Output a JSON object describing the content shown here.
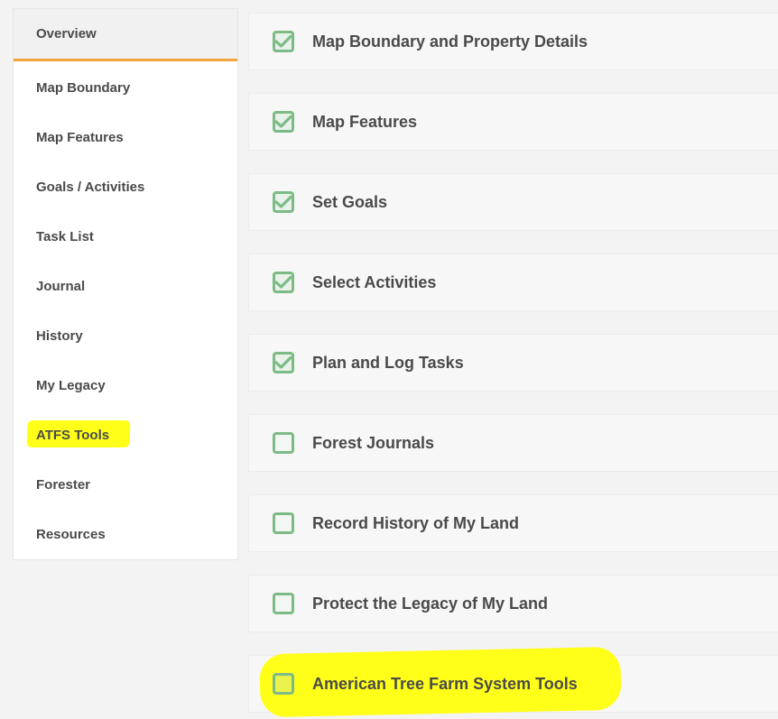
{
  "sidebar": {
    "items": [
      {
        "label": "Overview"
      },
      {
        "label": "Map Boundary"
      },
      {
        "label": "Map Features"
      },
      {
        "label": "Goals / Activities"
      },
      {
        "label": "Task List"
      },
      {
        "label": "Journal"
      },
      {
        "label": "History"
      },
      {
        "label": "My Legacy"
      },
      {
        "label": "ATFS Tools"
      },
      {
        "label": "Forester"
      },
      {
        "label": "Resources"
      }
    ],
    "active_index": 0
  },
  "tasks": [
    {
      "label": "Map Boundary and Property Details",
      "checked": true
    },
    {
      "label": "Map Features",
      "checked": true
    },
    {
      "label": "Set Goals",
      "checked": true
    },
    {
      "label": "Select Activities",
      "checked": true
    },
    {
      "label": "Plan and Log Tasks",
      "checked": true
    },
    {
      "label": "Forest Journals",
      "checked": false
    },
    {
      "label": "Record History of My Land",
      "checked": false
    },
    {
      "label": "Protect the Legacy of My Land",
      "checked": false
    },
    {
      "label": "American Tree Farm System Tools",
      "checked": false
    }
  ],
  "colors": {
    "accent": "#f0a43a",
    "checkbox": "#7dbb86",
    "highlight": "#ffff1a"
  }
}
